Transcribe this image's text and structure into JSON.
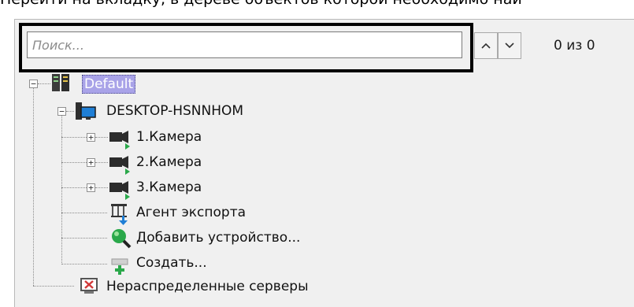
{
  "caption": "Перейти на вкладку, в дереве объектов которой необходимо най",
  "search": {
    "placeholder": "Поиск...",
    "value": "",
    "up_icon": "chevron-up-icon",
    "down_icon": "chevron-down-icon",
    "counter": "0 из 0"
  },
  "tree": {
    "root": {
      "label": "Default",
      "expander": "−",
      "icon": "server-rack-icon",
      "selected": true
    },
    "server": {
      "label": "DESKTOP-HSNNHOM",
      "expander": "−",
      "icon": "computer-server-icon"
    },
    "items": [
      {
        "label": "1.Камера",
        "expander": "+",
        "icon": "camera-icon"
      },
      {
        "label": "2.Камера",
        "expander": "+",
        "icon": "camera-icon"
      },
      {
        "label": "3.Камера",
        "expander": "+",
        "icon": "camera-icon"
      },
      {
        "label": "Агент экспорта",
        "icon": "export-agent-icon"
      },
      {
        "label": "Добавить устройство...",
        "icon": "add-device-search-icon"
      },
      {
        "label": "Создать...",
        "icon": "create-icon"
      }
    ],
    "unassigned": {
      "label": "Нераспределенные серверы",
      "icon": "unassigned-servers-icon"
    }
  },
  "colors": {
    "selection": "#a9a3e8",
    "camera_indicator": "#2aa84a",
    "panel_background": "#f0f0f0"
  }
}
